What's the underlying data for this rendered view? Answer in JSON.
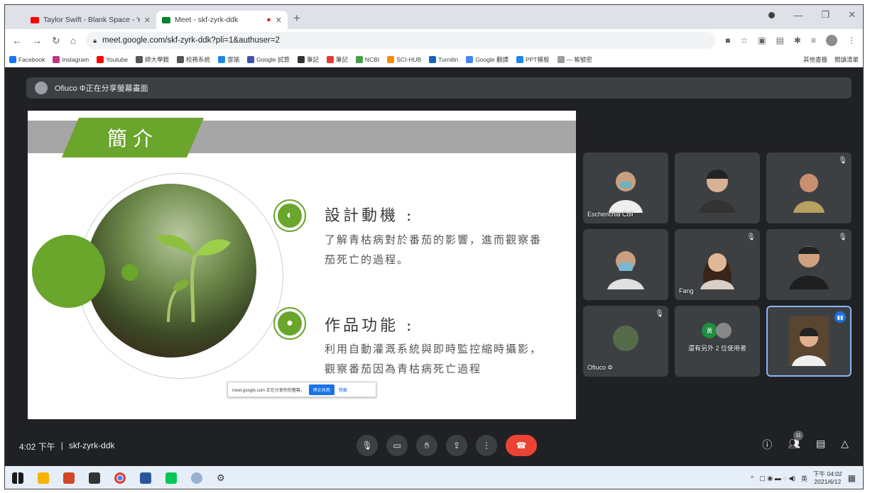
{
  "browser": {
    "tabs": [
      {
        "label": "Taylor Swift - Blank Space - Yo",
        "color": "#ff0000"
      },
      {
        "label": "Meet - skf-zyrk-ddk",
        "color": "#00832d"
      }
    ],
    "url": "meet.google.com/skf-zyrk-ddk?pli=1&authuser=2",
    "bookmarks": [
      {
        "label": "Facebook",
        "color": "#1877f2"
      },
      {
        "label": "Instagram",
        "color": "#c13584"
      },
      {
        "label": "Youtube",
        "color": "#ff0000"
      },
      {
        "label": "師大學籍",
        "color": "#555555"
      },
      {
        "label": "校務系統",
        "color": "#555555"
      },
      {
        "label": "雲端",
        "color": "#1e88e5"
      },
      {
        "label": "Google 試算",
        "color": "#3f51b5"
      },
      {
        "label": "筆記",
        "color": "#333333"
      },
      {
        "label": "筆記",
        "color": "#e53935"
      },
      {
        "label": "NCBI",
        "color": "#43a047"
      },
      {
        "label": "SCI-HUB",
        "color": "#fb8c00"
      },
      {
        "label": "Turnitin",
        "color": "#1565c0"
      },
      {
        "label": "Google 翻譯",
        "color": "#4285f4"
      },
      {
        "label": "PPT模板",
        "color": "#1e88e5"
      },
      {
        "label": "— 帳號密",
        "color": "#9e9e9e"
      }
    ],
    "bookmarks_right": [
      "其他書籤",
      "閱讀清單"
    ]
  },
  "meet": {
    "presenter_text": "Ofiuco Φ正在分享螢幕畫面",
    "time": "4:02 下午",
    "code": "skf-zyrk-ddk",
    "participant_count": "11",
    "share_bar": {
      "text": "meet.google.com 正在分享你的螢幕。",
      "stop": "停止共用",
      "hide": "隱藏"
    },
    "tiles": [
      {
        "name": "Escherichia Coli",
        "muted": false
      },
      {
        "name": "",
        "muted": false
      },
      {
        "name": "",
        "muted": true
      },
      {
        "name": "",
        "muted": false
      },
      {
        "name": "Fang",
        "muted": true
      },
      {
        "name": "",
        "muted": true
      },
      {
        "name": "Ofiuco Φ",
        "muted": true
      },
      {
        "name": "還有另外 2 位使用者",
        "muted": false
      },
      {
        "name": "",
        "muted": false
      }
    ]
  },
  "slide": {
    "title": "簡介",
    "section1_heading": "設計動機 :",
    "section1_text": "了解青枯病對於番茄的影響，進而觀察番茄死亡的過程。",
    "section2_heading": "作品功能 :",
    "section2_text": "利用自動灌溉系統與即時監控縮時攝影，觀察番茄因為青枯病死亡過程"
  },
  "taskbar": {
    "clock_time": "下午 04:02",
    "clock_date": "2021/6/12",
    "ime": "英"
  }
}
